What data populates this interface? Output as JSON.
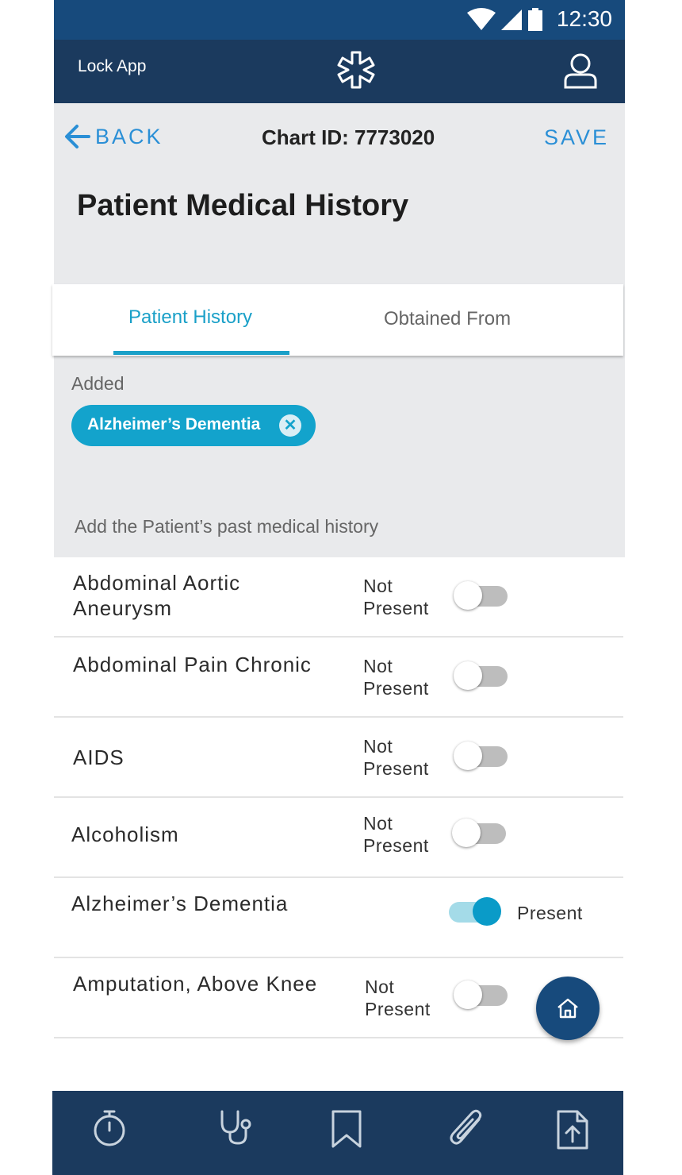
{
  "status": {
    "time": "12:30",
    "icons": [
      "wifi-icon",
      "signal-icon",
      "battery-icon"
    ]
  },
  "appbar": {
    "lock_label": "Lock App",
    "logo": "star-of-life-icon",
    "user": "user-icon"
  },
  "nav": {
    "back_label": "BACK",
    "chart_id": "Chart ID: 7773020",
    "save_label": "SAVE"
  },
  "page": {
    "title": "Patient Medical History"
  },
  "tabs": [
    {
      "label": "Patient History",
      "active": true
    },
    {
      "label": "Obtained From",
      "active": false
    }
  ],
  "added": {
    "label": "Added",
    "chips": [
      {
        "label": "Alzheimer’s Dementia"
      }
    ]
  },
  "hint": "Add the Patient’s past medical history",
  "history": [
    {
      "name": "Abdominal Aortic Aneurysm",
      "state_line1": "Not",
      "state_line2": "Present",
      "present": false
    },
    {
      "name": "Abdominal Pain Chronic",
      "state_line1": "Not",
      "state_line2": "Present",
      "present": false
    },
    {
      "name": "AIDS",
      "state_line1": "Not",
      "state_line2": "Present",
      "present": false
    },
    {
      "name": "Alcoholism",
      "state_line1": "Not",
      "state_line2": "Present",
      "present": false
    },
    {
      "name": "Alzheimer’s Dementia",
      "state_line1": "Present",
      "state_line2": "",
      "present": true
    },
    {
      "name": "Amputation, Above Knee",
      "state_line1": "Not",
      "state_line2": "Present",
      "present": false
    }
  ],
  "fab": {
    "icon": "home-icon"
  },
  "bottom_nav": [
    "timer-icon",
    "stethoscope-icon",
    "bookmark-icon",
    "paperclip-icon",
    "file-upload-icon"
  ],
  "colors": {
    "primary_dark": "#1b3a5e",
    "status_bar": "#174a7c",
    "accent": "#13a3cc",
    "link": "#2a8fd6"
  }
}
